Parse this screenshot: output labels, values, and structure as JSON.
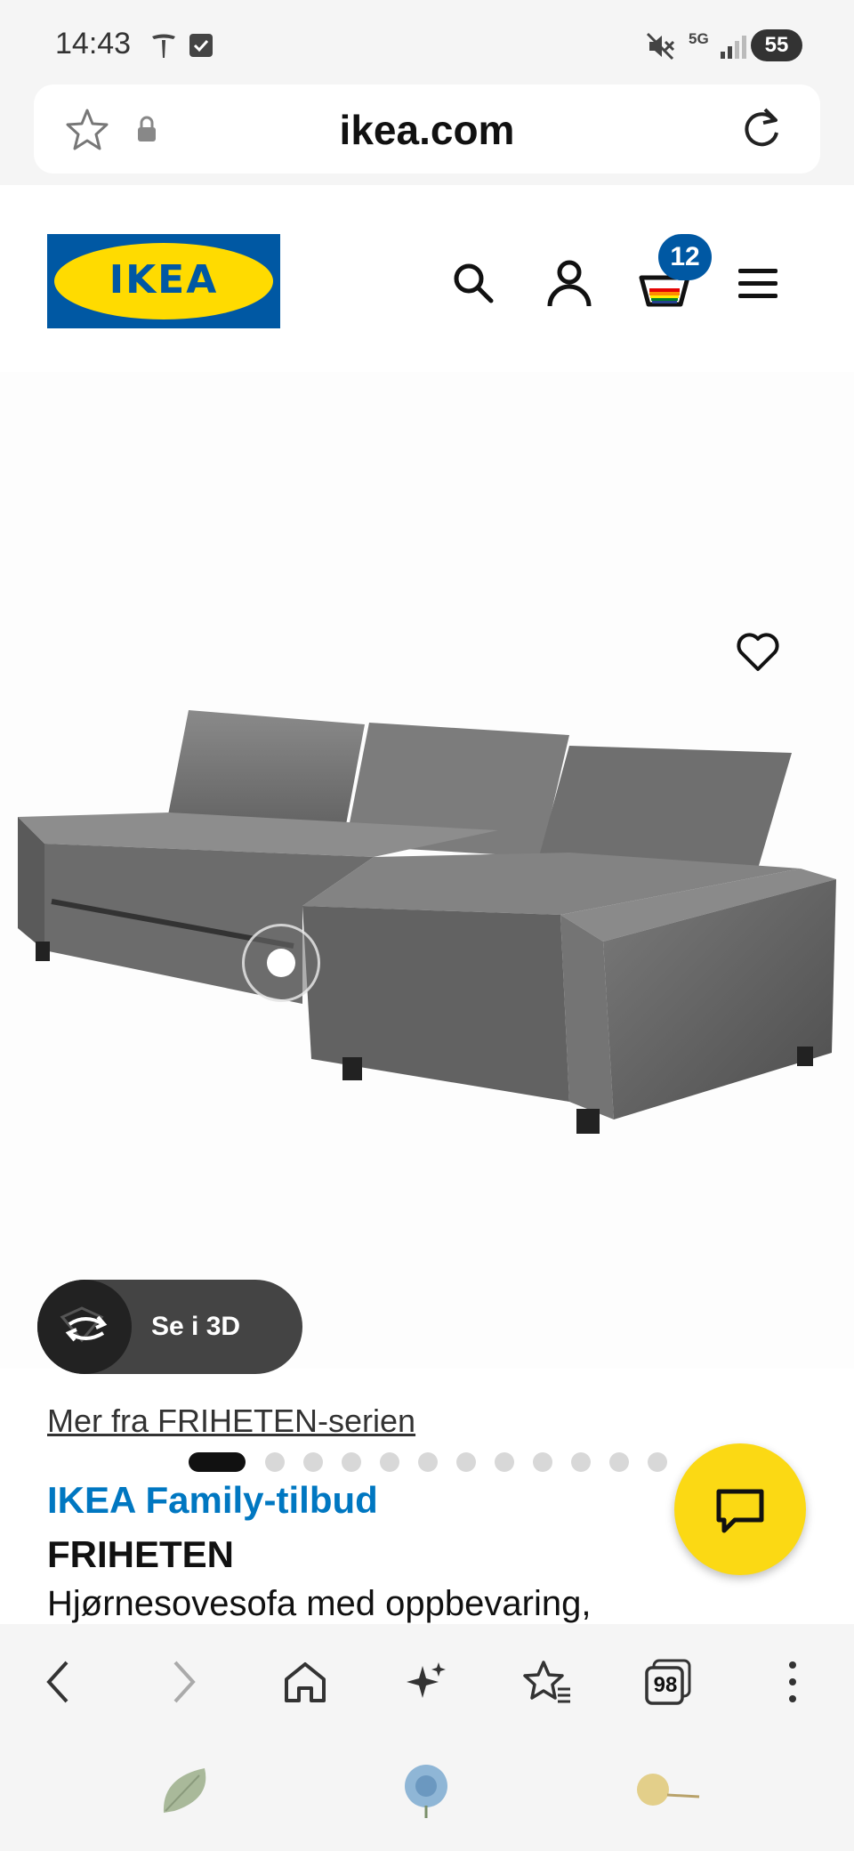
{
  "status_bar": {
    "time": "14:43",
    "battery": "55",
    "network": "5G"
  },
  "url_bar": {
    "url": "ikea.com"
  },
  "header": {
    "logo_text": "IKEA",
    "cart_count": "12"
  },
  "product": {
    "view_3d_label": "Se i 3D",
    "gallery_total": 12,
    "gallery_active": 1,
    "series_link": "Mer fra FRIHETEN-serien",
    "family_offer": "IKEA Family-tilbud",
    "name": "FRIHETEN",
    "description": "Hjørnesovesofa med oppbevaring,"
  },
  "browser_nav": {
    "tabs_count": "98"
  },
  "colors": {
    "ikea_blue": "#0058a3",
    "ikea_yellow": "#ffdb00",
    "family_blue": "#0077c1",
    "chat_yellow": "#fbd914"
  }
}
